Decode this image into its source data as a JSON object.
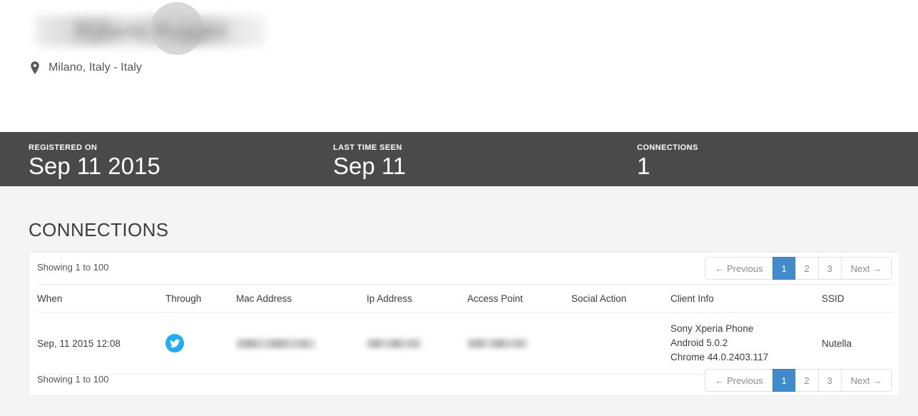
{
  "profile": {
    "name_redacted": "Roberto Ruggeri",
    "location": "Milano, Italy - Italy",
    "location_icon": "map-pin-icon"
  },
  "stats": [
    {
      "label": "REGISTERED ON",
      "value": "Sep 11 2015"
    },
    {
      "label": "LAST TIME SEEN",
      "value": "Sep 11"
    },
    {
      "label": "CONNECTIONS",
      "value": "1"
    }
  ],
  "section": {
    "title": "CONNECTIONS",
    "showing_text": "Showing 1 to 100"
  },
  "pagination": {
    "previous": "← Previous",
    "pages": [
      "1",
      "2",
      "3"
    ],
    "active_page": "1",
    "next": "Next →",
    "active_color": "#428bca"
  },
  "table": {
    "headers": [
      "When",
      "Through",
      "Mac Address",
      "Ip Address",
      "Access Point",
      "Social Action",
      "Client Info",
      "SSID"
    ],
    "rows": [
      {
        "when": "Sep, 11 2015 12:08",
        "through_icon": "twitter-icon",
        "through_color": "#21adee",
        "mac_address": "",
        "ip_address": "",
        "access_point": "",
        "social_action": "",
        "client_device": "Sony Xperia Phone",
        "client_os": "Android 5.0.2",
        "client_browser": "Chrome 44.0.2403.117",
        "ssid": "Nutella"
      }
    ]
  }
}
